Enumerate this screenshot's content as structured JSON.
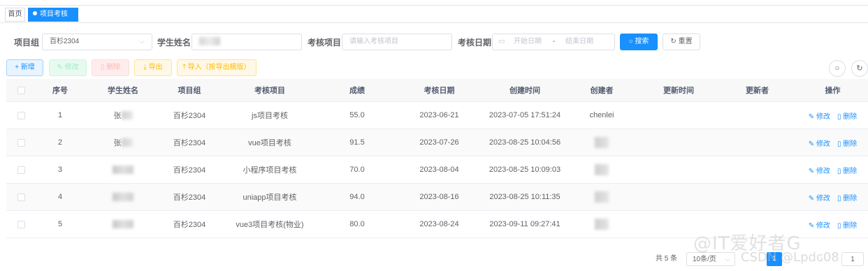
{
  "tabs": {
    "home": "首页",
    "active": "项目考核",
    "close": "×"
  },
  "search": {
    "group_label": "项目组",
    "group_value": "百杉2304",
    "name_label": "学生姓名",
    "project_label": "考核项目",
    "project_placeholder": "请输入考核项目",
    "date_label": "考核日期",
    "date_start_placeholder": "开始日期",
    "date_sep": "-",
    "date_end_placeholder": "结束日期",
    "search_btn": "搜索",
    "reset_btn": "重置"
  },
  "toolbar": {
    "add": "新增",
    "edit": "修改",
    "delete": "删除",
    "export": "导出",
    "import": "导入（按导出模版）"
  },
  "table": {
    "headers": [
      "序号",
      "学生姓名",
      "项目组",
      "考核项目",
      "成绩",
      "考核日期",
      "创建时间",
      "创建者",
      "更新时间",
      "更新者",
      "操作"
    ],
    "rows": [
      {
        "no": "1",
        "name_prefix": "张",
        "group": "百杉2304",
        "project": "js项目考核",
        "score": "55.0",
        "date": "2023-06-21",
        "created": "2023-07-05 17:51:24",
        "creator": "chenlei"
      },
      {
        "no": "2",
        "name_prefix": "张",
        "group": "百杉2304",
        "project": "vue项目考核",
        "score": "91.5",
        "date": "2023-07-26",
        "created": "2023-08-25 10:04:56",
        "creator": ""
      },
      {
        "no": "3",
        "name_prefix": "",
        "group": "百杉2304",
        "project": "小程序项目考核",
        "score": "70.0",
        "date": "2023-08-04",
        "created": "2023-08-25 10:09:03",
        "creator": ""
      },
      {
        "no": "4",
        "name_prefix": "",
        "group": "百杉2304",
        "project": "uniapp项目考核",
        "score": "94.0",
        "date": "2023-08-16",
        "created": "2023-08-25 10:11:35",
        "creator": ""
      },
      {
        "no": "5",
        "name_prefix": "",
        "group": "百杉2304",
        "project": "vue3项目考核(物业)",
        "score": "80.0",
        "date": "2023-08-24",
        "created": "2023-09-11 09:27:41",
        "creator": ""
      }
    ],
    "edit_label": "修改",
    "delete_label": "删除"
  },
  "pagination": {
    "total": "共 5 条",
    "page_size": "10条/页",
    "current_page": "1",
    "goto": "1"
  },
  "watermark": {
    "line1": "@IT爱好者G",
    "line2": "CSDN @Lpdc08"
  },
  "colors": {
    "primary": "#1890ff",
    "success": "#13ce66",
    "danger": "#ff4949",
    "warning": "#ffba00"
  }
}
